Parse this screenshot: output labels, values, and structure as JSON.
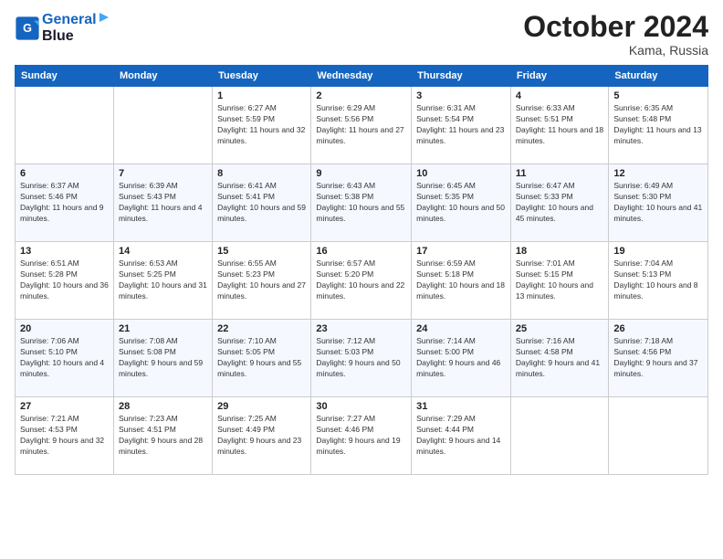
{
  "header": {
    "logo_line1": "General",
    "logo_line2": "Blue",
    "month": "October 2024",
    "location": "Kama, Russia"
  },
  "days_of_week": [
    "Sunday",
    "Monday",
    "Tuesday",
    "Wednesday",
    "Thursday",
    "Friday",
    "Saturday"
  ],
  "weeks": [
    [
      {
        "day": "",
        "sunrise": "",
        "sunset": "",
        "daylight": ""
      },
      {
        "day": "",
        "sunrise": "",
        "sunset": "",
        "daylight": ""
      },
      {
        "day": "1",
        "sunrise": "Sunrise: 6:27 AM",
        "sunset": "Sunset: 5:59 PM",
        "daylight": "Daylight: 11 hours and 32 minutes."
      },
      {
        "day": "2",
        "sunrise": "Sunrise: 6:29 AM",
        "sunset": "Sunset: 5:56 PM",
        "daylight": "Daylight: 11 hours and 27 minutes."
      },
      {
        "day": "3",
        "sunrise": "Sunrise: 6:31 AM",
        "sunset": "Sunset: 5:54 PM",
        "daylight": "Daylight: 11 hours and 23 minutes."
      },
      {
        "day": "4",
        "sunrise": "Sunrise: 6:33 AM",
        "sunset": "Sunset: 5:51 PM",
        "daylight": "Daylight: 11 hours and 18 minutes."
      },
      {
        "day": "5",
        "sunrise": "Sunrise: 6:35 AM",
        "sunset": "Sunset: 5:48 PM",
        "daylight": "Daylight: 11 hours and 13 minutes."
      }
    ],
    [
      {
        "day": "6",
        "sunrise": "Sunrise: 6:37 AM",
        "sunset": "Sunset: 5:46 PM",
        "daylight": "Daylight: 11 hours and 9 minutes."
      },
      {
        "day": "7",
        "sunrise": "Sunrise: 6:39 AM",
        "sunset": "Sunset: 5:43 PM",
        "daylight": "Daylight: 11 hours and 4 minutes."
      },
      {
        "day": "8",
        "sunrise": "Sunrise: 6:41 AM",
        "sunset": "Sunset: 5:41 PM",
        "daylight": "Daylight: 10 hours and 59 minutes."
      },
      {
        "day": "9",
        "sunrise": "Sunrise: 6:43 AM",
        "sunset": "Sunset: 5:38 PM",
        "daylight": "Daylight: 10 hours and 55 minutes."
      },
      {
        "day": "10",
        "sunrise": "Sunrise: 6:45 AM",
        "sunset": "Sunset: 5:35 PM",
        "daylight": "Daylight: 10 hours and 50 minutes."
      },
      {
        "day": "11",
        "sunrise": "Sunrise: 6:47 AM",
        "sunset": "Sunset: 5:33 PM",
        "daylight": "Daylight: 10 hours and 45 minutes."
      },
      {
        "day": "12",
        "sunrise": "Sunrise: 6:49 AM",
        "sunset": "Sunset: 5:30 PM",
        "daylight": "Daylight: 10 hours and 41 minutes."
      }
    ],
    [
      {
        "day": "13",
        "sunrise": "Sunrise: 6:51 AM",
        "sunset": "Sunset: 5:28 PM",
        "daylight": "Daylight: 10 hours and 36 minutes."
      },
      {
        "day": "14",
        "sunrise": "Sunrise: 6:53 AM",
        "sunset": "Sunset: 5:25 PM",
        "daylight": "Daylight: 10 hours and 31 minutes."
      },
      {
        "day": "15",
        "sunrise": "Sunrise: 6:55 AM",
        "sunset": "Sunset: 5:23 PM",
        "daylight": "Daylight: 10 hours and 27 minutes."
      },
      {
        "day": "16",
        "sunrise": "Sunrise: 6:57 AM",
        "sunset": "Sunset: 5:20 PM",
        "daylight": "Daylight: 10 hours and 22 minutes."
      },
      {
        "day": "17",
        "sunrise": "Sunrise: 6:59 AM",
        "sunset": "Sunset: 5:18 PM",
        "daylight": "Daylight: 10 hours and 18 minutes."
      },
      {
        "day": "18",
        "sunrise": "Sunrise: 7:01 AM",
        "sunset": "Sunset: 5:15 PM",
        "daylight": "Daylight: 10 hours and 13 minutes."
      },
      {
        "day": "19",
        "sunrise": "Sunrise: 7:04 AM",
        "sunset": "Sunset: 5:13 PM",
        "daylight": "Daylight: 10 hours and 8 minutes."
      }
    ],
    [
      {
        "day": "20",
        "sunrise": "Sunrise: 7:06 AM",
        "sunset": "Sunset: 5:10 PM",
        "daylight": "Daylight: 10 hours and 4 minutes."
      },
      {
        "day": "21",
        "sunrise": "Sunrise: 7:08 AM",
        "sunset": "Sunset: 5:08 PM",
        "daylight": "Daylight: 9 hours and 59 minutes."
      },
      {
        "day": "22",
        "sunrise": "Sunrise: 7:10 AM",
        "sunset": "Sunset: 5:05 PM",
        "daylight": "Daylight: 9 hours and 55 minutes."
      },
      {
        "day": "23",
        "sunrise": "Sunrise: 7:12 AM",
        "sunset": "Sunset: 5:03 PM",
        "daylight": "Daylight: 9 hours and 50 minutes."
      },
      {
        "day": "24",
        "sunrise": "Sunrise: 7:14 AM",
        "sunset": "Sunset: 5:00 PM",
        "daylight": "Daylight: 9 hours and 46 minutes."
      },
      {
        "day": "25",
        "sunrise": "Sunrise: 7:16 AM",
        "sunset": "Sunset: 4:58 PM",
        "daylight": "Daylight: 9 hours and 41 minutes."
      },
      {
        "day": "26",
        "sunrise": "Sunrise: 7:18 AM",
        "sunset": "Sunset: 4:56 PM",
        "daylight": "Daylight: 9 hours and 37 minutes."
      }
    ],
    [
      {
        "day": "27",
        "sunrise": "Sunrise: 7:21 AM",
        "sunset": "Sunset: 4:53 PM",
        "daylight": "Daylight: 9 hours and 32 minutes."
      },
      {
        "day": "28",
        "sunrise": "Sunrise: 7:23 AM",
        "sunset": "Sunset: 4:51 PM",
        "daylight": "Daylight: 9 hours and 28 minutes."
      },
      {
        "day": "29",
        "sunrise": "Sunrise: 7:25 AM",
        "sunset": "Sunset: 4:49 PM",
        "daylight": "Daylight: 9 hours and 23 minutes."
      },
      {
        "day": "30",
        "sunrise": "Sunrise: 7:27 AM",
        "sunset": "Sunset: 4:46 PM",
        "daylight": "Daylight: 9 hours and 19 minutes."
      },
      {
        "day": "31",
        "sunrise": "Sunrise: 7:29 AM",
        "sunset": "Sunset: 4:44 PM",
        "daylight": "Daylight: 9 hours and 14 minutes."
      },
      {
        "day": "",
        "sunrise": "",
        "sunset": "",
        "daylight": ""
      },
      {
        "day": "",
        "sunrise": "",
        "sunset": "",
        "daylight": ""
      }
    ]
  ]
}
